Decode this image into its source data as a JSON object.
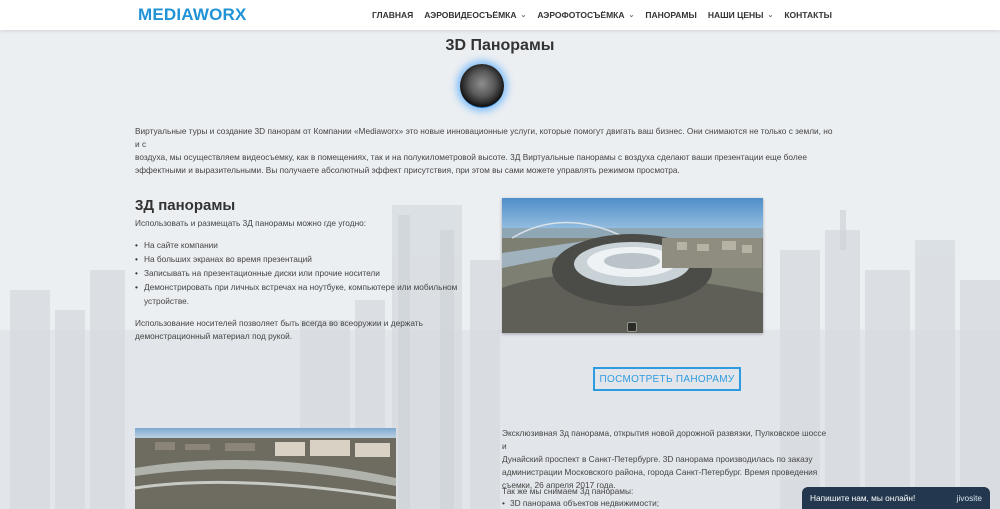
{
  "header": {
    "logo": "MEDIAWORX",
    "nav": [
      {
        "label": "ГЛАВНАЯ",
        "dropdown": false
      },
      {
        "label": "АЭРОВИДЕОСЪЁМКА",
        "dropdown": true
      },
      {
        "label": "АЭРОФОТОСЪЁМКА",
        "dropdown": true
      },
      {
        "label": "ПАНОРАМЫ",
        "dropdown": false
      },
      {
        "label": "НАШИ ЦЕНЫ",
        "dropdown": true
      },
      {
        "label": "КОНТАКТЫ",
        "dropdown": false
      }
    ],
    "chevron": "⌄"
  },
  "main": {
    "page_title": "3D Панорамы",
    "intro_line1": "Виртуальные туры и создание 3D панорам от Компании «Mediaworx» это новые инновационные услуги, которые помогут двигать ваш бизнес. Они снимаются не только с земли, но и с",
    "intro_line2": "воздуха, мы осуществляем видеосъемку, как в помещениях, так и на полукилометровой высоте. 3Д Виртуальные панорамы с воздуха сделают ваши презентации еще более",
    "intro_line3": "эффектными и выразительными. Вы получаете абсолютный эффект присутствия, при этом вы сами можете управлять режимом просмотра.",
    "section_title": "3Д панорамы",
    "usage_lead": "Использовать и размещать 3Д панорамы можно где угодно:",
    "usage_items": [
      "На сайте компании",
      "На больших экранах во время презентаций",
      "Записывать на презентационные диски или прочие носители",
      "Демонстрировать при личных встречах на ноутбуке, компьютере или мобильном устройстве."
    ],
    "note_line1": "Использование носителей позволяет быть всегда во всеоружии и держать",
    "note_line2": "демонстрационный материал под рукой.",
    "view_button": "ПОСМОТРЕТЬ ПАНОРАМУ",
    "desc_line1": "Эксклюзивная 3д панорама, открытия новой дорожной развязки, Пулковское шоссе и",
    "desc_line2": "Дунайский проспект в Санкт-Петербурге. 3D панорама производилась по заказу",
    "desc_line3": "администрации Московского района, города Санкт-Петербург. Время проведения",
    "desc_line4": "съемки, 26 апреля 2017 года.",
    "also_lead": "Так же мы снимаем 3д панорамы:",
    "also_items": [
      "3D панорама объектов недвижимости;"
    ]
  },
  "chat": {
    "text": "Напишите нам, мы онлайн!",
    "brand": "jivosite"
  },
  "colors": {
    "accent": "#1f93d6",
    "button_border": "#2e9be0",
    "chat_bg": "#23384f"
  },
  "icons": [
    "panorama-orb-icon",
    "chevron-down-icon",
    "panorama-control-icon"
  ]
}
